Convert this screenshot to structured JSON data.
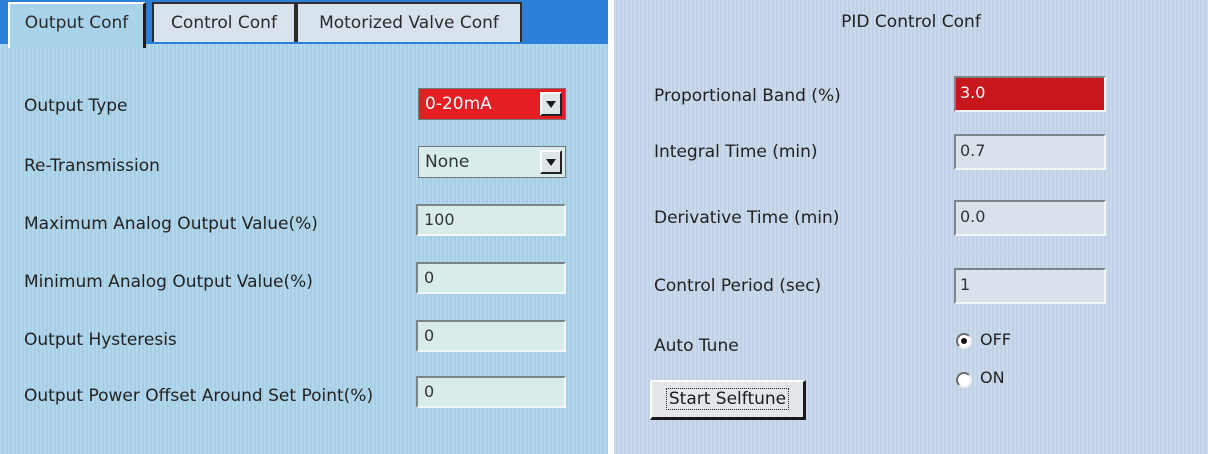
{
  "output_panel": {
    "tabs": [
      "Output Conf",
      "Control Conf",
      "Motorized Valve Conf"
    ],
    "active_tab": "Output Conf",
    "rows": [
      {
        "label": "Output Type",
        "value": "0-20mA"
      },
      {
        "label": "Re-Transmission",
        "value": "None"
      },
      {
        "label": "Maximum Analog Output Value(%)",
        "value": "100"
      },
      {
        "label": "Minimum Analog Output Value(%)",
        "value": "0"
      },
      {
        "label": "Output Hysteresis",
        "value": "0"
      },
      {
        "label": "Output Power Offset Around Set Point(%)",
        "value": "0"
      }
    ]
  },
  "pid_panel": {
    "title": "PID Control Conf",
    "rows": [
      {
        "label": "Proportional Band (%)",
        "value": "3.0"
      },
      {
        "label": "Integral Time (min)",
        "value": "0.7"
      },
      {
        "label": "Derivative Time (min)",
        "value": "0.0"
      },
      {
        "label": "Control Period (sec)",
        "value": "1"
      }
    ],
    "auto_tune": {
      "label": "Auto Tune",
      "options": [
        "OFF",
        "ON"
      ],
      "selected": "OFF"
    },
    "start_button": "Start Selftune"
  },
  "colors": {
    "left_bg": "#a9d3ea",
    "right_bg": "#c5d5ea",
    "tab_strip": "#2b7fd9",
    "highlight_red": "#e51e24"
  }
}
